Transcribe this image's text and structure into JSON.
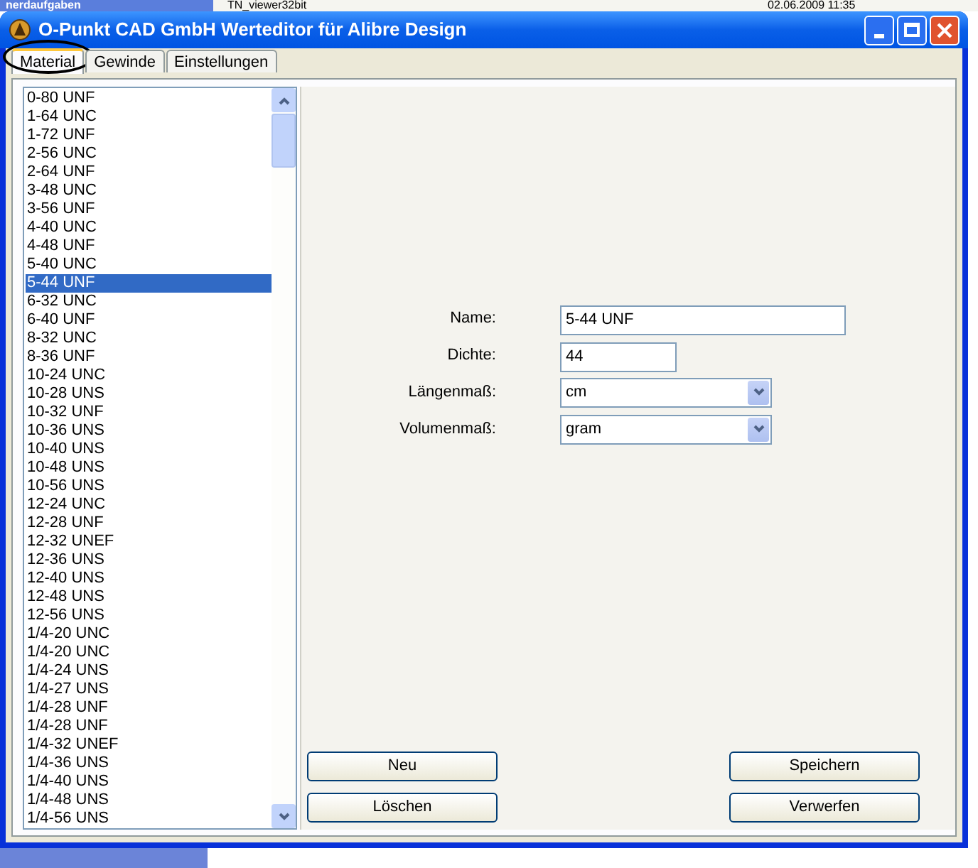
{
  "desktop": {
    "texts": [
      "nerdaufgaben",
      "TN_viewer32bit",
      "02.06.2009 11:35"
    ]
  },
  "window": {
    "title": "O-Punkt CAD GmbH Werteditor für Alibre Design"
  },
  "tabs": [
    {
      "label": "Material",
      "selected": true,
      "circled": true
    },
    {
      "label": "Gewinde",
      "selected": false,
      "circled": false
    },
    {
      "label": "Einstellungen",
      "selected": false,
      "circled": false
    }
  ],
  "list": {
    "items": [
      {
        "label": "0-80 UNF",
        "selected": false
      },
      {
        "label": "1-64 UNC",
        "selected": false
      },
      {
        "label": "1-72 UNF",
        "selected": false
      },
      {
        "label": "2-56 UNC",
        "selected": false
      },
      {
        "label": "2-64 UNF",
        "selected": false
      },
      {
        "label": "3-48 UNC",
        "selected": false
      },
      {
        "label": "3-56 UNF",
        "selected": false
      },
      {
        "label": "4-40 UNC",
        "selected": false
      },
      {
        "label": "4-48 UNF",
        "selected": false
      },
      {
        "label": "5-40 UNC",
        "selected": false
      },
      {
        "label": "5-44 UNF",
        "selected": true
      },
      {
        "label": "6-32 UNC",
        "selected": false
      },
      {
        "label": "6-40 UNF",
        "selected": false
      },
      {
        "label": "8-32 UNC",
        "selected": false
      },
      {
        "label": "8-36 UNF",
        "selected": false
      },
      {
        "label": "10-24 UNC",
        "selected": false
      },
      {
        "label": "10-28 UNS",
        "selected": false
      },
      {
        "label": "10-32 UNF",
        "selected": false
      },
      {
        "label": "10-36 UNS",
        "selected": false
      },
      {
        "label": "10-40 UNS",
        "selected": false
      },
      {
        "label": "10-48 UNS",
        "selected": false
      },
      {
        "label": "10-56 UNS",
        "selected": false
      },
      {
        "label": "12-24 UNC",
        "selected": false
      },
      {
        "label": "12-28 UNF",
        "selected": false
      },
      {
        "label": "12-32 UNEF",
        "selected": false
      },
      {
        "label": "12-36 UNS",
        "selected": false
      },
      {
        "label": "12-40 UNS",
        "selected": false
      },
      {
        "label": "12-48 UNS",
        "selected": false
      },
      {
        "label": "12-56 UNS",
        "selected": false
      },
      {
        "label": "1/4-20 UNC",
        "selected": false
      },
      {
        "label": "1/4-20 UNC",
        "selected": false
      },
      {
        "label": "1/4-24 UNS",
        "selected": false
      },
      {
        "label": "1/4-27 UNS",
        "selected": false
      },
      {
        "label": "1/4-28 UNF",
        "selected": false
      },
      {
        "label": "1/4-28 UNF",
        "selected": false
      },
      {
        "label": "1/4-32 UNEF",
        "selected": false
      },
      {
        "label": "1/4-36 UNS",
        "selected": false
      },
      {
        "label": "1/4-40 UNS",
        "selected": false
      },
      {
        "label": "1/4-48 UNS",
        "selected": false
      },
      {
        "label": "1/4-56 UNS",
        "selected": false
      }
    ]
  },
  "form": {
    "fields": [
      {
        "kind": "text",
        "label": "Name:",
        "value": "5-44 UNF"
      },
      {
        "kind": "number",
        "label": "Dichte:",
        "value": "44"
      },
      {
        "kind": "select",
        "label": "Längenmaß:",
        "value": "cm"
      },
      {
        "kind": "select",
        "label": "Volumenmaß:",
        "value": "gram"
      }
    ]
  },
  "buttons_left": [
    "Neu",
    "Löschen"
  ],
  "buttons_right": [
    "Speichern",
    "Verwerfen"
  ]
}
